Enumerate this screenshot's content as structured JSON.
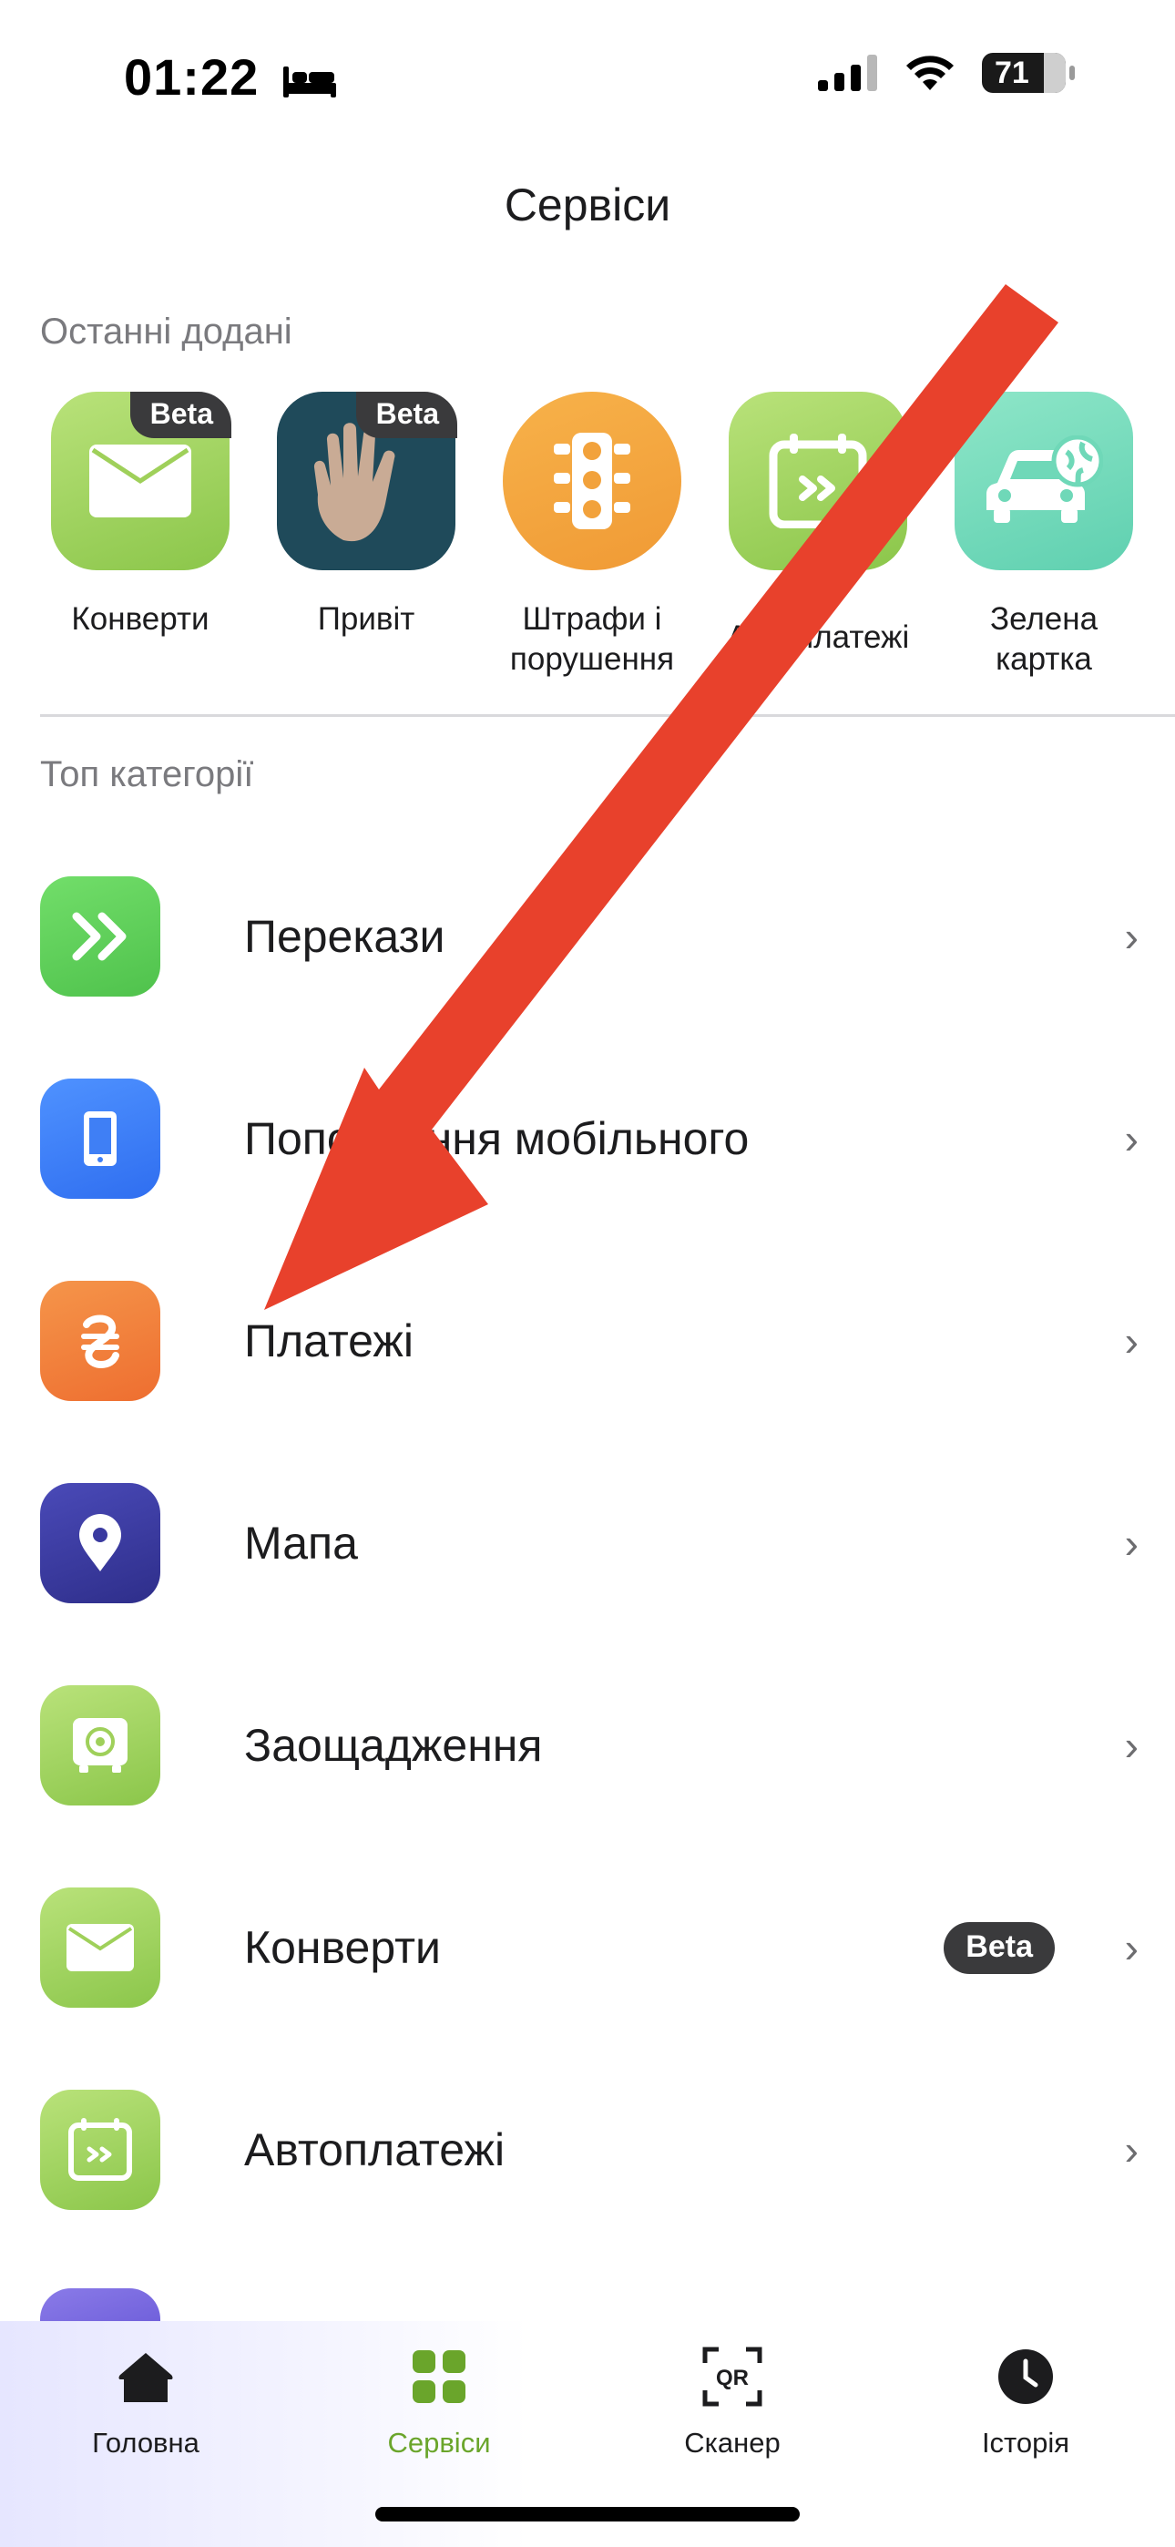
{
  "status_bar": {
    "time": "01:22",
    "battery": "71"
  },
  "header": {
    "title": "Сервіси"
  },
  "recent": {
    "label": "Останні додані",
    "items": [
      {
        "label": "Конверти",
        "badge": "Beta",
        "icon": "envelope-icon"
      },
      {
        "label": "Привіт",
        "badge": "Beta",
        "icon": "waving-hand-icon"
      },
      {
        "label": "Штрафи і порушення",
        "icon": "traffic-light-icon"
      },
      {
        "label": "Автоплатежі",
        "icon": "calendar-autopay-icon"
      },
      {
        "label": "Зелена картка",
        "icon": "car-globe-icon"
      }
    ]
  },
  "top_categories": {
    "label": "Топ категорії",
    "items": [
      {
        "label": "Перекази",
        "icon": "double-chevron-icon",
        "color": "#5fd05a"
      },
      {
        "label": "Поповнення мобільного",
        "icon": "phone-icon",
        "color": "#3f7ff5"
      },
      {
        "label": "Платежі",
        "icon": "hryvnia-icon",
        "color": "#f0783a"
      },
      {
        "label": "Мапа",
        "icon": "map-pin-icon",
        "color": "#3a3aa0"
      },
      {
        "label": "Заощадження",
        "icon": "safe-icon",
        "color": "#9fd05a"
      },
      {
        "label": "Конверти",
        "icon": "envelope-icon",
        "color": "#9fd05a",
        "badge": "Beta"
      },
      {
        "label": "Автоплатежі",
        "icon": "calendar-autopay-icon",
        "color": "#9fd05a"
      }
    ]
  },
  "tabbar": {
    "active_color": "#6aa52b",
    "items": [
      {
        "label": "Головна",
        "icon": "home-icon"
      },
      {
        "label": "Сервіси",
        "icon": "grid-icon",
        "active": true
      },
      {
        "label": "Сканер",
        "icon": "qr-scan-icon",
        "qr_text": "QR"
      },
      {
        "label": "Історія",
        "icon": "clock-icon"
      }
    ]
  },
  "annotation": {
    "arrow_color": "#e8412c"
  }
}
